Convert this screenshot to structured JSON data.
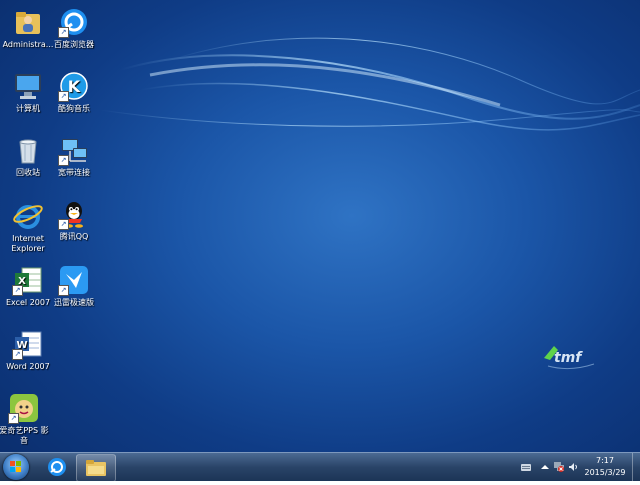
{
  "desktop": {
    "icons": [
      {
        "label": "Administra...",
        "icon": "user-folder-icon"
      },
      {
        "label": "百度浏览器",
        "icon": "baidu-browser-icon"
      },
      {
        "label": "计算机",
        "icon": "computer-icon"
      },
      {
        "label": "酷狗音乐",
        "icon": "kugou-music-icon"
      },
      {
        "label": "回收站",
        "icon": "recycle-bin-icon"
      },
      {
        "label": "宽带连接",
        "icon": "broadband-connection-icon"
      },
      {
        "label": "Internet Explorer",
        "icon": "internet-explorer-icon"
      },
      {
        "label": "腾讯QQ",
        "icon": "qq-icon"
      },
      {
        "label": "Excel 2007",
        "icon": "excel-icon"
      },
      {
        "label": "迅雷极速版",
        "icon": "xunlei-icon"
      },
      {
        "label": "Word 2007",
        "icon": "word-icon"
      },
      {
        "label": "爱奇艺PPS 影音",
        "icon": "iqiyi-pps-icon"
      }
    ],
    "brand_logo": "tmf-logo"
  },
  "taskbar": {
    "start": "windows-start-icon",
    "pinned": [
      "baidu-browser-icon",
      "file-explorer-icon"
    ],
    "tray": [
      "keyboard-icon",
      "show-hidden-icons",
      "network-error-icon",
      "volume-icon"
    ],
    "clock": {
      "time": "7:17",
      "date": "2015/3/29"
    }
  },
  "colors": {
    "desktop_bg": "#1b56a8",
    "taskbar_bg": "#2a4468"
  }
}
